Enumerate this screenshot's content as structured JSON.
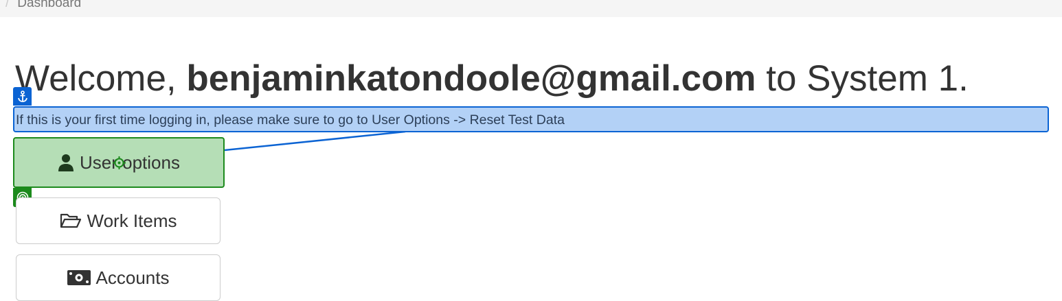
{
  "breadcrumb": {
    "separator": "/",
    "current": "Dashboard"
  },
  "welcome": {
    "prefix": "Welcome, ",
    "user_email": "benjaminkatondoole@gmail.com",
    "suffix": " to System 1."
  },
  "notice": {
    "text": "If this is your first time logging in, please make sure to go to User Options -> Reset Test Data"
  },
  "menu": {
    "user_options": {
      "label": "User options",
      "icon": "user-icon"
    },
    "work_items": {
      "label": "Work Items",
      "icon": "folder-open-icon"
    },
    "accounts": {
      "label": "Accounts",
      "icon": "money-bill-icon"
    }
  },
  "overlay": {
    "anchor_icon": "anchor-icon",
    "target_icon": "target-icon",
    "anchor_color": "#0b63d3",
    "target_color": "#1c8a1c"
  },
  "colors": {
    "highlight_fill": "#b3d1f6",
    "highlight_border": "#0b63d3",
    "button_highlight_fill": "#b5deb6",
    "text": "#333333"
  }
}
